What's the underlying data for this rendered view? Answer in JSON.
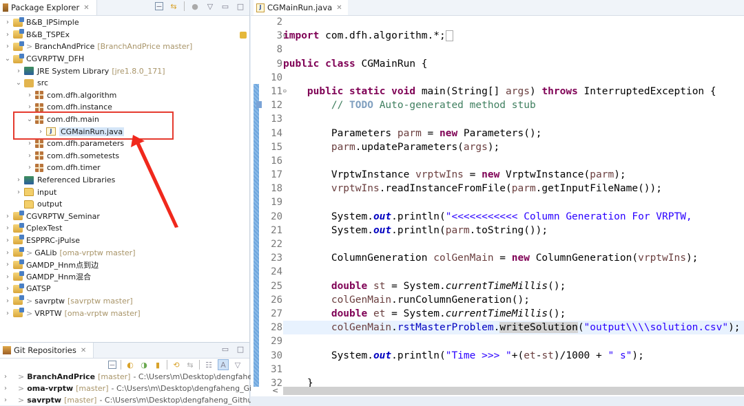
{
  "package_explorer": {
    "title": "Package Explorer",
    "close_glyph": "✕",
    "tools": [
      "collapse-all-icon",
      "link-with-editor-icon",
      "filter-icon",
      "view-menu-icon",
      "minimize-icon",
      "maximize-icon"
    ],
    "items": [
      {
        "label": "B&B_IPSimple",
        "arrow": ">",
        "type": "project",
        "prefix": "",
        "branch": ""
      },
      {
        "label": "B&B_TSPEx",
        "arrow": ">",
        "type": "project",
        "prefix": "",
        "branch": ""
      },
      {
        "label": "BranchAndPrice",
        "arrow": ">",
        "type": "project",
        "prefix": ">",
        "branch": "[BranchAndPrice master]"
      },
      {
        "label": "CGVRPTW_DFH",
        "arrow": "v",
        "type": "project",
        "prefix": "",
        "branch": ""
      },
      {
        "label": "JRE System Library",
        "arrow": ">",
        "type": "library",
        "prefix": "",
        "branch": "[jre1.8.0_171]"
      },
      {
        "label": "src",
        "arrow": "v",
        "type": "source-folder",
        "prefix": "",
        "branch": ""
      },
      {
        "label": "com.dfh.algorithm",
        "arrow": ">",
        "type": "package",
        "prefix": "",
        "branch": ""
      },
      {
        "label": "com.dfh.instance",
        "arrow": ">",
        "type": "package",
        "prefix": "",
        "branch": ""
      },
      {
        "label": "com.dfh.main",
        "arrow": "v",
        "type": "package",
        "prefix": "",
        "branch": ""
      },
      {
        "label": "CGMainRun.java",
        "arrow": ">",
        "type": "java-file",
        "prefix": "",
        "branch": "",
        "selected": true
      },
      {
        "label": "com.dfh.parameters",
        "arrow": ">",
        "type": "package",
        "prefix": "",
        "branch": ""
      },
      {
        "label": "com.dfh.sometests",
        "arrow": ">",
        "type": "package",
        "prefix": "",
        "branch": ""
      },
      {
        "label": "com.dfh.timer",
        "arrow": ">",
        "type": "package",
        "prefix": "",
        "branch": ""
      },
      {
        "label": "Referenced Libraries",
        "arrow": ">",
        "type": "library",
        "prefix": "",
        "branch": ""
      },
      {
        "label": "input",
        "arrow": ">",
        "type": "folder",
        "prefix": "",
        "branch": ""
      },
      {
        "label": "output",
        "arrow": "",
        "type": "folder",
        "prefix": "",
        "branch": ""
      },
      {
        "label": "CGVRPTW_Seminar",
        "arrow": ">",
        "type": "project",
        "prefix": "",
        "branch": ""
      },
      {
        "label": "CplexTest",
        "arrow": ">",
        "type": "project",
        "prefix": "",
        "branch": ""
      },
      {
        "label": "ESPPRC-jPulse",
        "arrow": ">",
        "type": "project",
        "prefix": "",
        "branch": ""
      },
      {
        "label": "GALib",
        "arrow": ">",
        "type": "project",
        "prefix": ">",
        "branch": "[oma-vrptw master]"
      },
      {
        "label": "GAMDP_Hnm点到边",
        "arrow": ">",
        "type": "project",
        "prefix": "",
        "branch": ""
      },
      {
        "label": "GAMDP_Hnm混合",
        "arrow": ">",
        "type": "project",
        "prefix": "",
        "branch": ""
      },
      {
        "label": "GATSP",
        "arrow": ">",
        "type": "project",
        "prefix": "",
        "branch": ""
      },
      {
        "label": "savrptw",
        "arrow": ">",
        "type": "project",
        "prefix": ">",
        "branch": "[savrptw master]"
      },
      {
        "label": "VRPTW",
        "arrow": ">",
        "type": "project",
        "prefix": ">",
        "branch": "[oma-vrptw master]"
      }
    ]
  },
  "git_repositories": {
    "title": "Git Repositories",
    "close_glyph": "✕",
    "repos": [
      {
        "name": "BranchAndPrice",
        "branch": "[master]",
        "path": "- C:\\Users\\m\\Desktop\\dengfaheng_"
      },
      {
        "name": "oma-vrptw",
        "branch": "[master]",
        "path": "- C:\\Users\\m\\Desktop\\dengfaheng_Githu"
      },
      {
        "name": "savrptw",
        "branch": "[master]",
        "path": "- C:\\Users\\m\\Desktop\\dengfaheng_Github\\"
      }
    ]
  },
  "editor": {
    "tab_label": "CGMainRun.java",
    "close_glyph": "✕",
    "line_numbers": [
      "2",
      "3",
      "8",
      "9",
      "10",
      "11",
      "12",
      "13",
      "14",
      "15",
      "16",
      "17",
      "18",
      "19",
      "20",
      "21",
      "22",
      "23",
      "24",
      "25",
      "26",
      "27",
      "28",
      "29",
      "30",
      "31",
      "32"
    ],
    "current_line": "28",
    "scroll_left_glyph": "<"
  }
}
